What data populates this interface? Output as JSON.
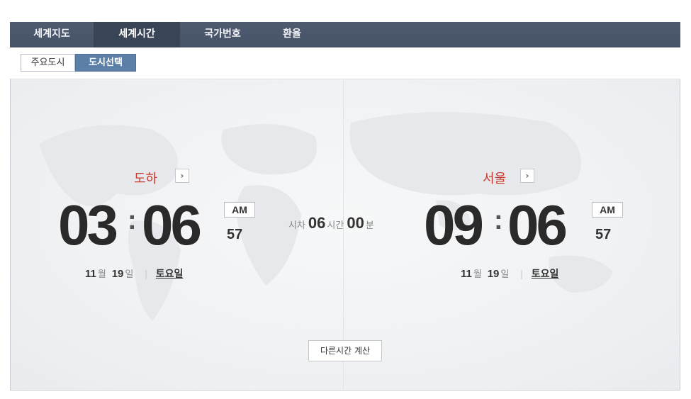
{
  "tabs": [
    {
      "label": "세계지도",
      "active": false
    },
    {
      "label": "세계시간",
      "active": true
    },
    {
      "label": "국가번호",
      "active": false
    },
    {
      "label": "환율",
      "active": false
    }
  ],
  "subtabs": [
    {
      "label": "주요도시",
      "selected": false
    },
    {
      "label": "도시선택",
      "selected": true
    }
  ],
  "left_clock": {
    "city": "도하",
    "hour": "03",
    "minute": "06",
    "ampm": "AM",
    "seconds": "57",
    "month": "11",
    "month_unit": "월",
    "day": "19",
    "day_unit": "일",
    "weekday": "토요일"
  },
  "right_clock": {
    "city": "서울",
    "hour": "09",
    "minute": "06",
    "ampm": "AM",
    "seconds": "57",
    "month": "11",
    "month_unit": "월",
    "day": "19",
    "day_unit": "일",
    "weekday": "토요일"
  },
  "time_difference": {
    "prefix": "시차",
    "hours": "06",
    "hours_unit": "시간",
    "minutes": "00",
    "minutes_unit": "분"
  },
  "calc_button_label": "다른시간 계산",
  "arrow_glyph": "›",
  "colon_glyph": ":",
  "date_separator": "|",
  "colors": {
    "tabbar": "#4b566b",
    "active_tab": "#394457",
    "selected_subtab": "#5c7fa8",
    "city_label": "#c83a2e"
  }
}
